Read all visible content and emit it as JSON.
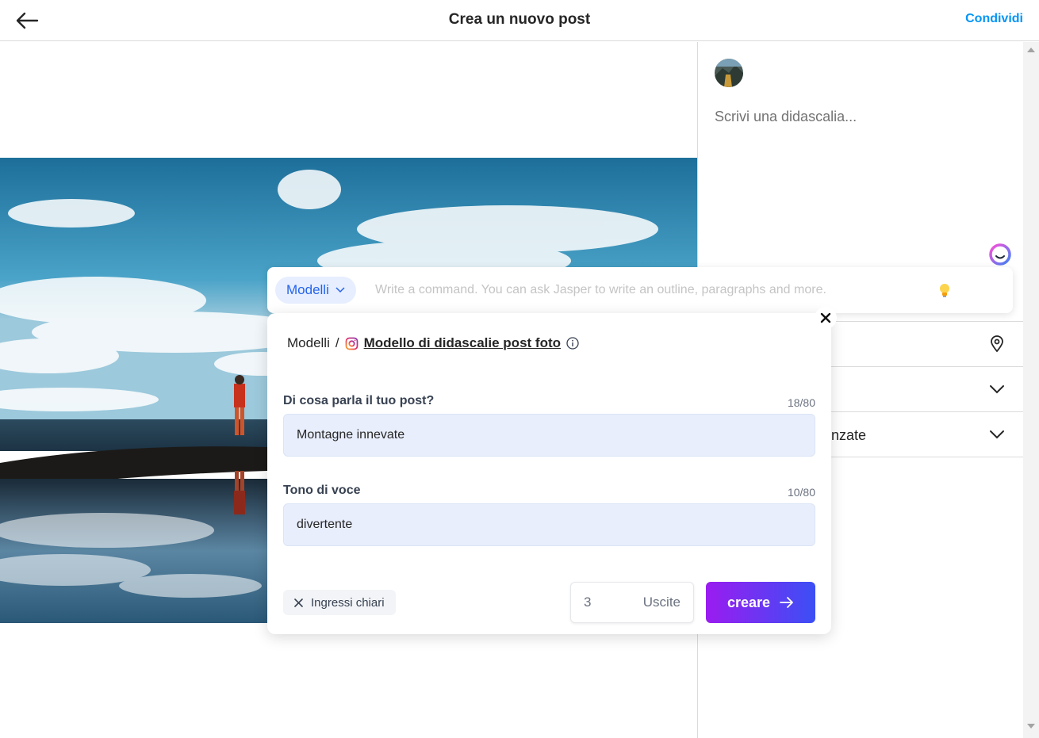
{
  "header": {
    "title": "Crea un nuovo post",
    "share_label": "Condividi"
  },
  "side": {
    "caption_placeholder": "Scrivi una didascalia...",
    "rows": [
      {
        "label": "",
        "icon": "location-pin-icon"
      },
      {
        "label": "",
        "icon": "chevron-down-icon"
      },
      {
        "label": "nzate",
        "icon": "chevron-down-icon"
      }
    ]
  },
  "command_bar": {
    "models_label": "Modelli",
    "placeholder": "Write a command. You can ask Jasper to write an outline, paragraphs and more."
  },
  "template": {
    "breadcrumb_root": "Modelli",
    "breadcrumb_sep": "/",
    "name": "Modello di didascalie post foto",
    "fields": [
      {
        "label": "Di cosa parla il tuo post?",
        "count": "18/80",
        "value": "Montagne innevate"
      },
      {
        "label": "Tono di voce",
        "count": "10/80",
        "value": "divertente"
      }
    ],
    "clear_label": "Ingressi chiari",
    "outputs_value": "3",
    "outputs_label": "Uscite",
    "create_label": "creare"
  },
  "colors": {
    "accent": "#0095f6",
    "chip_bg": "#e6eeff",
    "field_bg": "#e8eefc",
    "gradient_start": "#9b1cf0",
    "gradient_end": "#3b4ff5"
  }
}
